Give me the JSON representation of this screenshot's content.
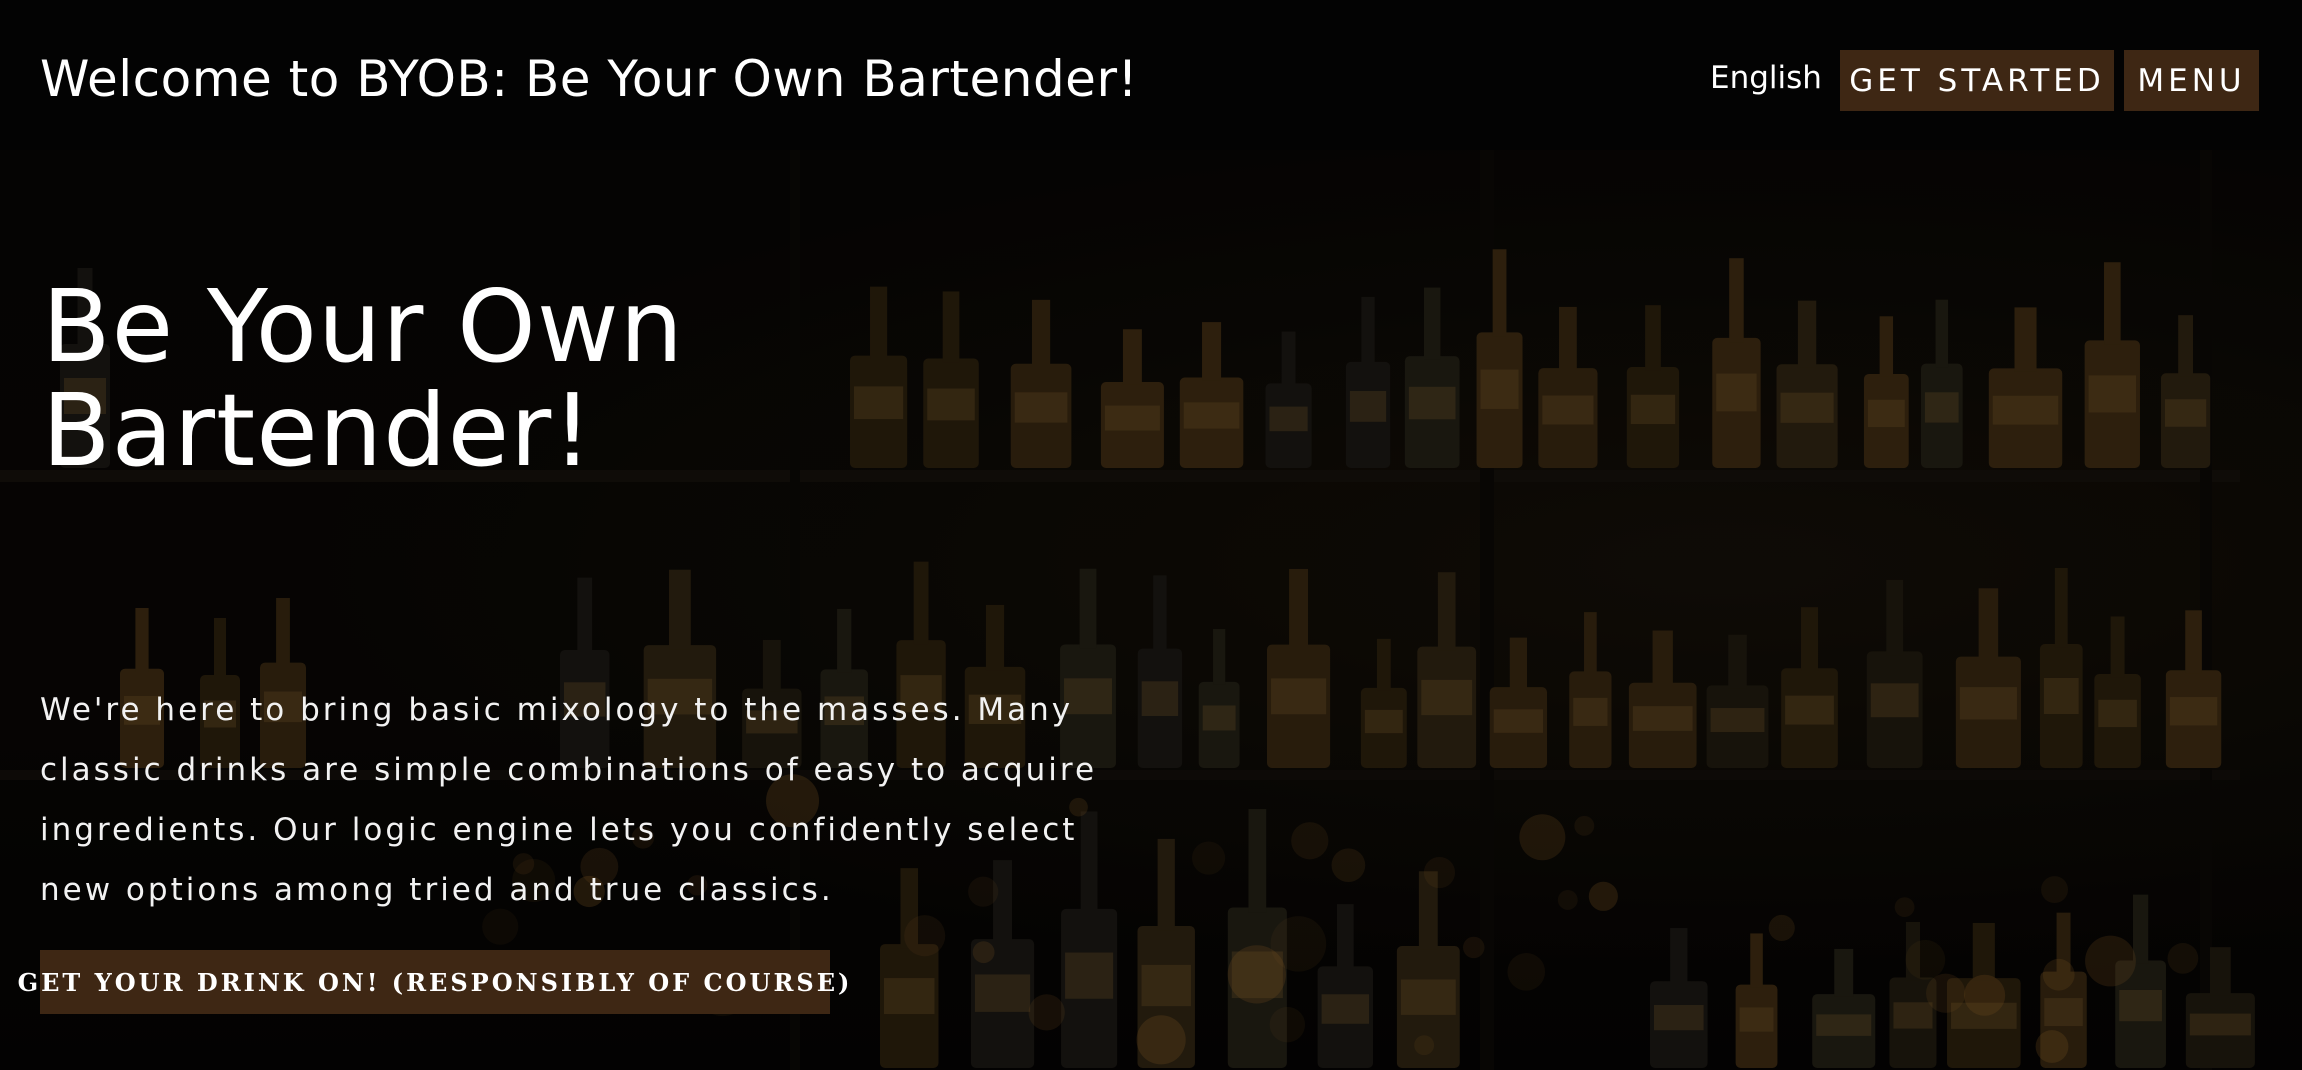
{
  "header": {
    "site_title": "Welcome to BYOB: Be Your Own Bartender!",
    "language": "English",
    "get_started_label": "GET STARTED",
    "menu_label": "MENU"
  },
  "hero": {
    "title": "Be Your Own Bartender!",
    "description": "We're here to bring basic mixology to the masses. Many classic drinks are simple combinations of easy to acquire ingredients. Our logic engine lets you confidently select new options among tried and true classics.",
    "cta_label": "GET YOUR DRINK ON! (RESPONSIBLY OF COURSE)"
  },
  "colors": {
    "button_bg": "#3e2714",
    "header_bg": "#030303"
  }
}
